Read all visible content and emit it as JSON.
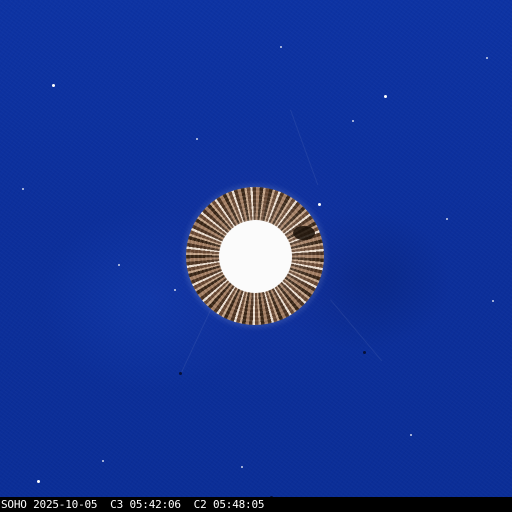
{
  "image": {
    "caption": "SOHO 2025-10-05  C3 05:42:06  C2 05:48:05"
  },
  "colors": {
    "background": "#0c2f9a",
    "sun_disk": "#fbfbfb",
    "label_text": "#ffffff",
    "label_bar": "#000000"
  }
}
